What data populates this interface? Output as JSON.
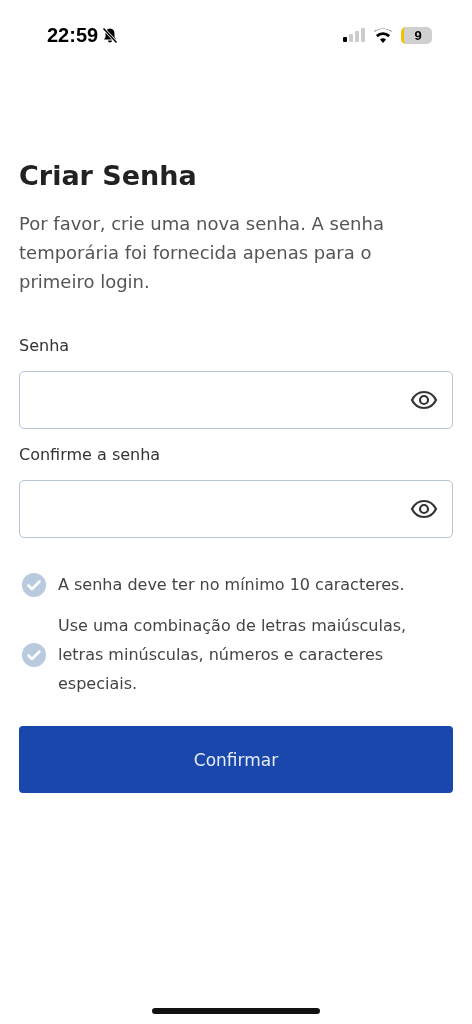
{
  "status_bar": {
    "time": "22:59",
    "battery": "9"
  },
  "title": "Criar Senha",
  "description": "Por favor, crie uma nova senha. A senha temporária foi fornecida apenas para o primeiro login.",
  "fields": [
    {
      "label": "Senha"
    },
    {
      "label": "Confirme a senha"
    }
  ],
  "requirements": [
    {
      "text": "A senha deve ter no mínimo 10 caracteres.",
      "met": false
    },
    {
      "text": "Use uma combinação de letras maiúsculas, letras minúsculas, números e caracteres especiais.",
      "met": false
    }
  ],
  "button": {
    "label": "Confirmar",
    "disabled": false
  }
}
